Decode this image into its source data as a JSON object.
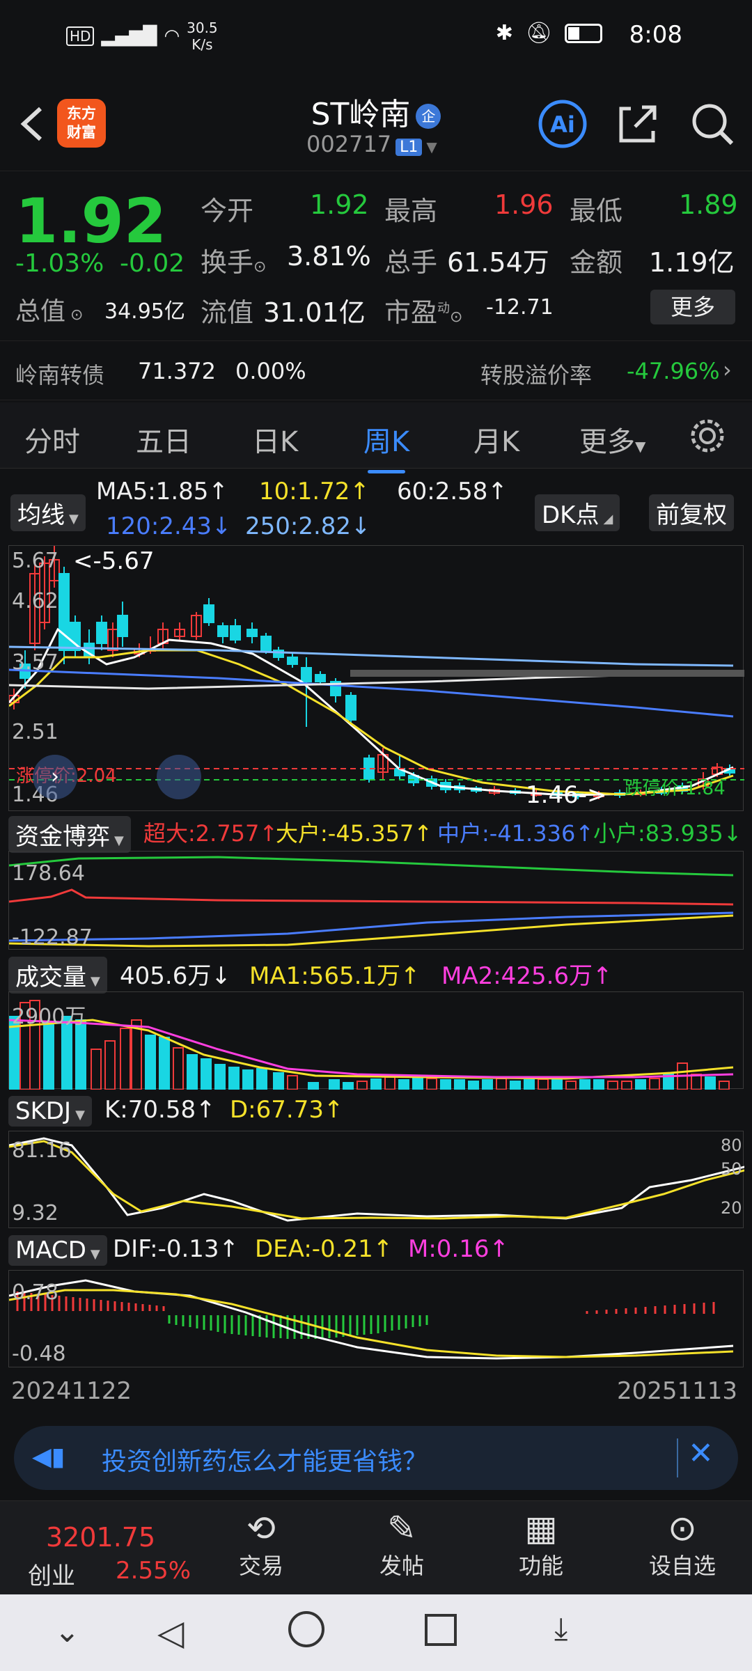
{
  "status": {
    "net_left": "HD",
    "speed_value": "30.5",
    "speed_unit": "K/s",
    "time": "8:08"
  },
  "header": {
    "logo_line1": "东方",
    "logo_line2": "财富",
    "name": "ST岭南",
    "badge": "企",
    "code": "002717",
    "level": "L1"
  },
  "quote": {
    "price": "1.92",
    "change_pct": "-1.03%",
    "change": "-0.02",
    "open_label": "今开",
    "open": "1.92",
    "high_label": "最高",
    "high": "1.96",
    "low_label": "最低",
    "low": "1.89",
    "turnover_label": "换手",
    "turnover": "3.81%",
    "volume_label": "总手",
    "volume": "61.54万",
    "amount_label": "金额",
    "amount": "1.19亿",
    "mcap_label": "总值",
    "mcap": "34.95亿",
    "float_label": "流值",
    "float_cap": "31.01亿",
    "pe_label": "市盈",
    "pe_sup": "动",
    "pe": "-12.71",
    "more": "更多"
  },
  "bond": {
    "name": "岭南转债",
    "price": "71.372",
    "pct": "0.00%",
    "premium_label": "转股溢价率",
    "premium": "-47.96%"
  },
  "tabs": [
    {
      "label": "分时"
    },
    {
      "label": "五日"
    },
    {
      "label": "日K"
    },
    {
      "label": "周K"
    },
    {
      "label": "月K"
    },
    {
      "label": "更多"
    }
  ],
  "ma": {
    "selector": "均线",
    "ma5": "MA5:1.85↑",
    "ma10": "10:1.72↑",
    "ma60": "60:2.58↑",
    "ma120": "120:2.43↓",
    "ma250": "250:2.82↓",
    "dk": "DK点",
    "adjust": "前复权"
  },
  "kline": {
    "y_labels": [
      "5.67",
      "4.62",
      "3.57",
      "2.51",
      "1.46"
    ],
    "max_marker": "<-5.67",
    "min_marker": "1.46->",
    "limit_up": "涨停价:2.04",
    "limit_down": "跌停价:1.84"
  },
  "fund": {
    "selector": "资金博弈",
    "super": "超大:2.757↑",
    "large": "大户:-45.357↑",
    "mid": "中户:-41.336↑",
    "small": "小户:83.935↓",
    "y_top": "178.64",
    "y_bot": "-122.87"
  },
  "vol": {
    "selector": "成交量",
    "value": "405.6万↓",
    "ma1": "MA1:565.1万↑",
    "ma2": "MA2:425.6万↑",
    "y_top": "2900万"
  },
  "skdj": {
    "selector": "SKDJ",
    "k": "K:70.58↑",
    "d": "D:67.73↑",
    "y_top": "81.16",
    "y_bot": "9.32",
    "r80": "80",
    "r50": "50",
    "r20": "20"
  },
  "macd": {
    "selector": "MACD",
    "dif": "DIF:-0.13↑",
    "dea": "DEA:-0.21↑",
    "m": "M:0.16↑",
    "y_top": "0.78",
    "y_bot": "-0.48"
  },
  "dates": {
    "start": "20241122",
    "end": "20251113"
  },
  "ad": {
    "text": "投资创新药怎么才能更省钱？"
  },
  "nav": {
    "index_value": "3201.75",
    "index_name": "创业",
    "index_pct": "2.55%",
    "trade": "交易",
    "post": "发帖",
    "func": "功能",
    "watch": "设自选"
  },
  "colors": {
    "up": "#f03a3a",
    "down": "#25c93d",
    "accent": "#3b8cff",
    "candle_down": "#19d6e3"
  }
}
